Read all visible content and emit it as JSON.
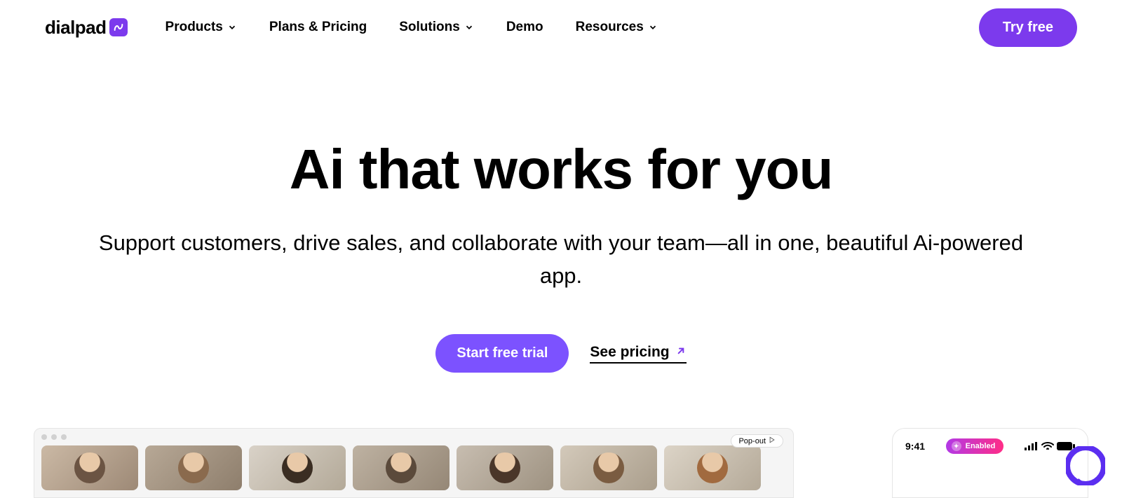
{
  "brand": {
    "name": "dialpad"
  },
  "nav": {
    "items": [
      {
        "label": "Products",
        "has_dropdown": true
      },
      {
        "label": "Plans & Pricing",
        "has_dropdown": false
      },
      {
        "label": "Solutions",
        "has_dropdown": true
      },
      {
        "label": "Demo",
        "has_dropdown": false
      },
      {
        "label": "Resources",
        "has_dropdown": true
      }
    ],
    "cta": "Try free"
  },
  "hero": {
    "headline": "Ai that works for you",
    "subhead": "Support customers, drive sales, and collaborate with your team—all in one, beautiful Ai-powered app.",
    "primary_cta": "Start free trial",
    "secondary_cta": "See pricing"
  },
  "preview": {
    "popout_label": "Pop-out",
    "phone": {
      "time": "9:41",
      "pill_label": "Enabled"
    }
  },
  "colors": {
    "accent": "#7c3aed"
  }
}
